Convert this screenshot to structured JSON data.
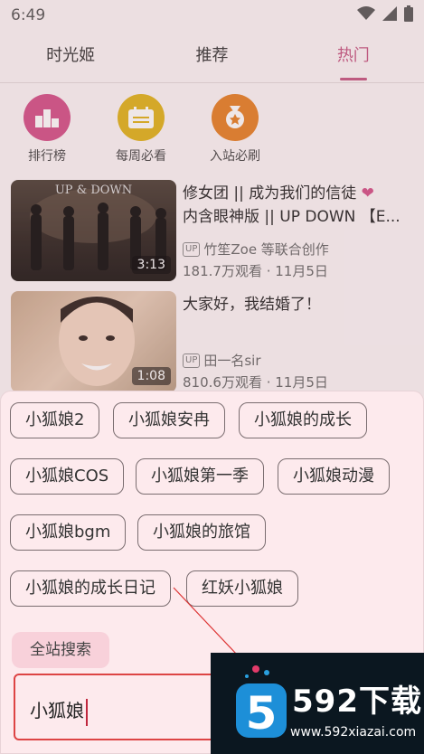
{
  "status": {
    "time": "6:49"
  },
  "tabs": [
    {
      "label": "时光姬",
      "active": false
    },
    {
      "label": "推荐",
      "active": false
    },
    {
      "label": "热门",
      "active": true
    }
  ],
  "shortcuts": [
    {
      "label": "排行榜",
      "icon": "ranking-icon",
      "color": "#d44d87"
    },
    {
      "label": "每周必看",
      "icon": "calendar-icon",
      "color": "#e0b316"
    },
    {
      "label": "入站必刷",
      "icon": "medal-icon",
      "color": "#e67e22"
    }
  ],
  "videos": [
    {
      "title_line1": "修女团 || 成为我们的信徒",
      "title_heart": "❤",
      "title_line2": "内含眼神版 || UP DOWN 【E...",
      "thumb_caption": "UP & DOWN",
      "duration": "3:13",
      "uploader": "竹笙Zoe 等联合创作",
      "stats": "181.7万观看 · 11月5日"
    },
    {
      "title_line1": "大家好，我结婚了！",
      "duration": "1:08",
      "uploader": "田一名sir",
      "stats": "810.6万观看 · 11月5日"
    }
  ],
  "upbadge": "UP",
  "suggestions": [
    "小狐娘2",
    "小狐娘安冉",
    "小狐娘的成长",
    "小狐娘COS",
    "小狐娘第一季",
    "小狐娘动漫",
    "小狐娘bgm",
    "小狐娘的旅馆",
    "小狐娘的成长日记",
    "红妖小狐娘"
  ],
  "site_search_label": "全站搜索",
  "search": {
    "value": "小狐娘"
  },
  "watermark": {
    "logo_text": "592下载",
    "url": "www.592xiazai.com"
  },
  "colors": {
    "accent": "#c55480",
    "sheet_bg": "#fdeaed",
    "search_border": "#dd4444"
  }
}
